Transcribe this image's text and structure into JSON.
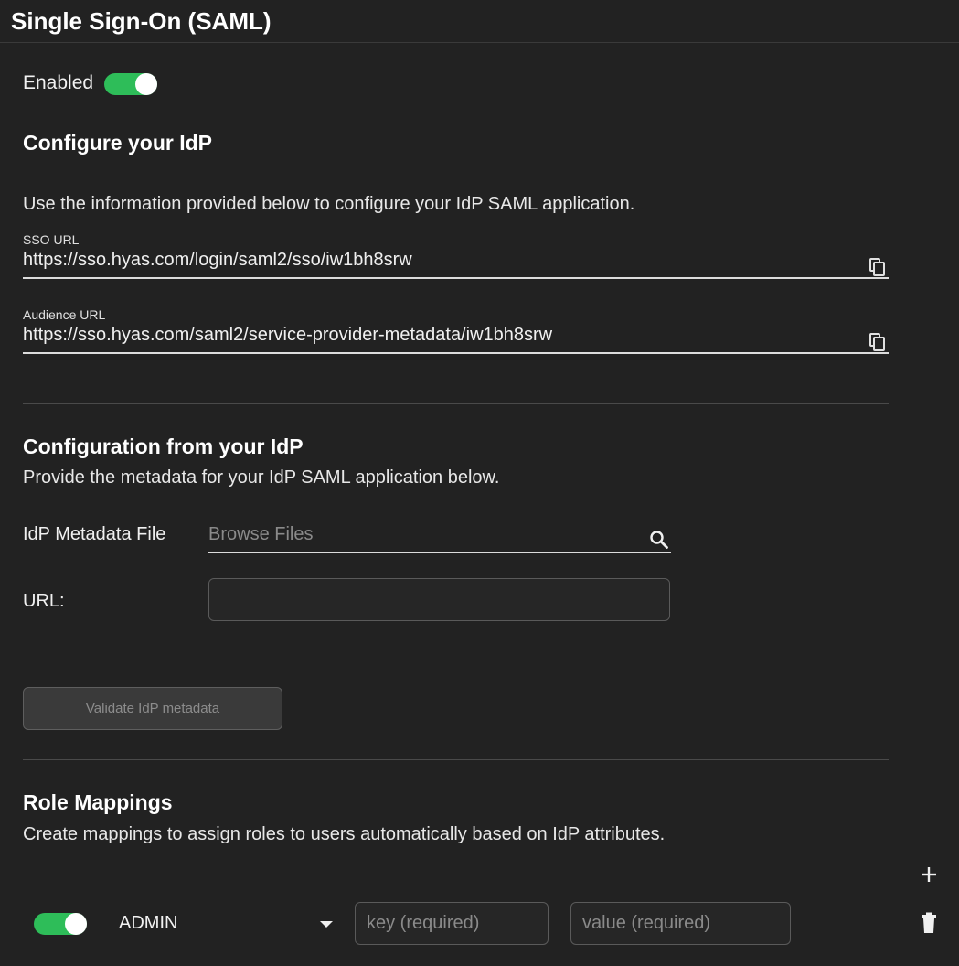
{
  "header": {
    "title": "Single Sign-On (SAML)"
  },
  "enabled": {
    "label": "Enabled",
    "on": true
  },
  "configure_idp": {
    "title": "Configure your IdP",
    "description": "Use the information provided below to configure your IdP SAML application.",
    "sso_url": {
      "label": "SSO URL",
      "value": "https://sso.hyas.com/login/saml2/sso/iw1bh8srw"
    },
    "audience_url": {
      "label": "Audience URL",
      "value": "https://sso.hyas.com/saml2/service-provider-metadata/iw1bh8srw"
    }
  },
  "config_from_idp": {
    "title": "Configuration from your IdP",
    "description": "Provide the metadata for your IdP SAML application below.",
    "metadata_file_label": "IdP Metadata File",
    "browse_placeholder": "Browse Files",
    "url_label": "URL:",
    "url_value": "",
    "validate_label": "Validate IdP metadata"
  },
  "role_mappings": {
    "title": "Role Mappings",
    "description": "Create mappings to assign roles to users automatically based on IdP attributes.",
    "rows": [
      {
        "enabled": true,
        "role": "ADMIN",
        "key_placeholder": "key (required)",
        "value_placeholder": "value (required)"
      }
    ]
  },
  "colors": {
    "background": "#222222",
    "toggle_on": "#2ebd59"
  },
  "icons": [
    "copy-icon",
    "search-icon",
    "chevron-down-icon",
    "plus-icon",
    "trash-icon"
  ]
}
